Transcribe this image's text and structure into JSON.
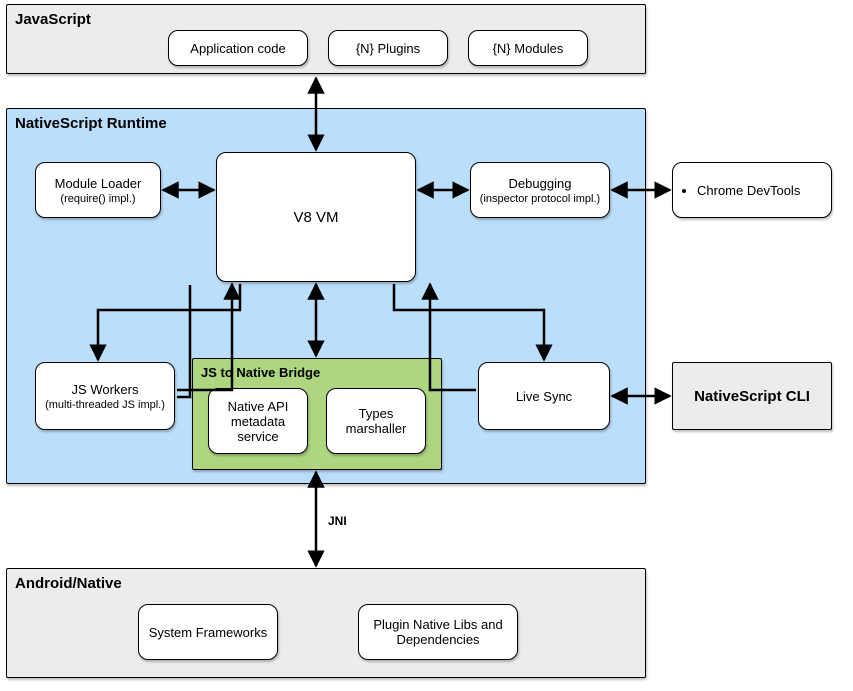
{
  "javascript": {
    "title": "JavaScript",
    "app_code": "Application code",
    "plugins": "{N} Plugins",
    "modules": "{N} Modules"
  },
  "runtime": {
    "title": "NativeScript Runtime",
    "module_loader": {
      "title": "Module Loader",
      "sub": "(require() impl.)"
    },
    "v8": "V8 VM",
    "debugging": {
      "title": "Debugging",
      "sub": "(inspector protocol impl.)"
    },
    "js_workers": {
      "title": "JS Workers",
      "sub": "(multi-threaded JS impl.)"
    },
    "bridge": {
      "title": "JS to Native Bridge",
      "metadata": "Native API metadata service",
      "marshaller": "Types marshaller"
    },
    "live_sync": "Live Sync"
  },
  "devtools": "Chrome DevTools",
  "cli": "NativeScript CLI",
  "jni_label": "JNI",
  "native": {
    "title": "Android/Native",
    "system_frameworks": "System Frameworks",
    "plugin_libs": "Plugin Native Libs and Dependencies"
  },
  "chart_data": {
    "type": "diagram",
    "nodes": [
      {
        "id": "javascript",
        "label": "JavaScript",
        "type": "container",
        "children": [
          "app_code",
          "plugins",
          "modules"
        ]
      },
      {
        "id": "app_code",
        "label": "Application code"
      },
      {
        "id": "plugins",
        "label": "{N} Plugins"
      },
      {
        "id": "modules",
        "label": "{N} Modules"
      },
      {
        "id": "runtime",
        "label": "NativeScript Runtime",
        "type": "container",
        "children": [
          "module_loader",
          "v8",
          "debugging",
          "js_workers",
          "bridge",
          "live_sync"
        ]
      },
      {
        "id": "module_loader",
        "label": "Module Loader",
        "sub": "(require() impl.)"
      },
      {
        "id": "v8",
        "label": "V8 VM"
      },
      {
        "id": "debugging",
        "label": "Debugging",
        "sub": "(inspector protocol impl.)"
      },
      {
        "id": "js_workers",
        "label": "JS Workers",
        "sub": "(multi-threaded JS impl.)"
      },
      {
        "id": "bridge",
        "label": "JS to Native Bridge",
        "type": "container",
        "children": [
          "metadata",
          "marshaller"
        ]
      },
      {
        "id": "metadata",
        "label": "Native API metadata service"
      },
      {
        "id": "marshaller",
        "label": "Types marshaller"
      },
      {
        "id": "live_sync",
        "label": "Live Sync"
      },
      {
        "id": "devtools",
        "label": "Chrome DevTools"
      },
      {
        "id": "cli",
        "label": "NativeScript CLI"
      },
      {
        "id": "native",
        "label": "Android/Native",
        "type": "container",
        "children": [
          "system_frameworks",
          "plugin_libs"
        ]
      },
      {
        "id": "system_frameworks",
        "label": "System Frameworks"
      },
      {
        "id": "plugin_libs",
        "label": "Plugin Native Libs and Dependencies"
      }
    ],
    "edges": [
      {
        "from": "javascript",
        "to": "v8",
        "dir": "both"
      },
      {
        "from": "module_loader",
        "to": "v8",
        "dir": "both"
      },
      {
        "from": "v8",
        "to": "debugging",
        "dir": "both"
      },
      {
        "from": "debugging",
        "to": "devtools",
        "dir": "both"
      },
      {
        "from": "v8",
        "to": "js_workers",
        "dir": "to"
      },
      {
        "from": "js_workers",
        "to": "v8",
        "dir": "to"
      },
      {
        "from": "v8",
        "to": "live_sync",
        "dir": "to"
      },
      {
        "from": "live_sync",
        "to": "v8",
        "dir": "to"
      },
      {
        "from": "v8",
        "to": "bridge",
        "dir": "both"
      },
      {
        "from": "live_sync",
        "to": "cli",
        "dir": "both"
      },
      {
        "from": "bridge",
        "to": "native",
        "dir": "both",
        "label": "JNI"
      }
    ]
  }
}
